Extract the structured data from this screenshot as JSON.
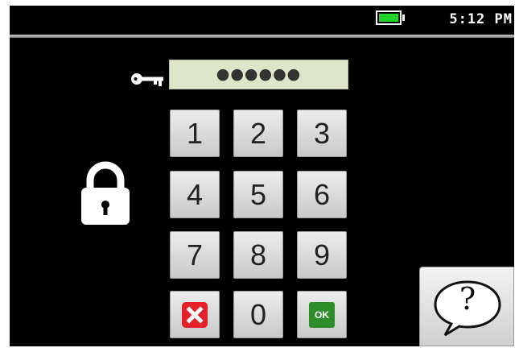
{
  "status_bar": {
    "battery_level": 1.0,
    "battery_color": "#22d32a",
    "time": "5:12 PM"
  },
  "pin_entry": {
    "icon": "key-icon",
    "masked_value": "●●●●●●"
  },
  "lock": {
    "icon": "lock-icon"
  },
  "keypad": {
    "keys": [
      "1",
      "2",
      "3",
      "4",
      "5",
      "6",
      "7",
      "8",
      "9"
    ],
    "zero": "0",
    "delete_icon": "delete-icon",
    "ok_label": "OK"
  },
  "help": {
    "label": "?"
  },
  "colors": {
    "delete": "#e42028",
    "ok": "#2d8d2a",
    "pin_field": "#dde6c8"
  }
}
